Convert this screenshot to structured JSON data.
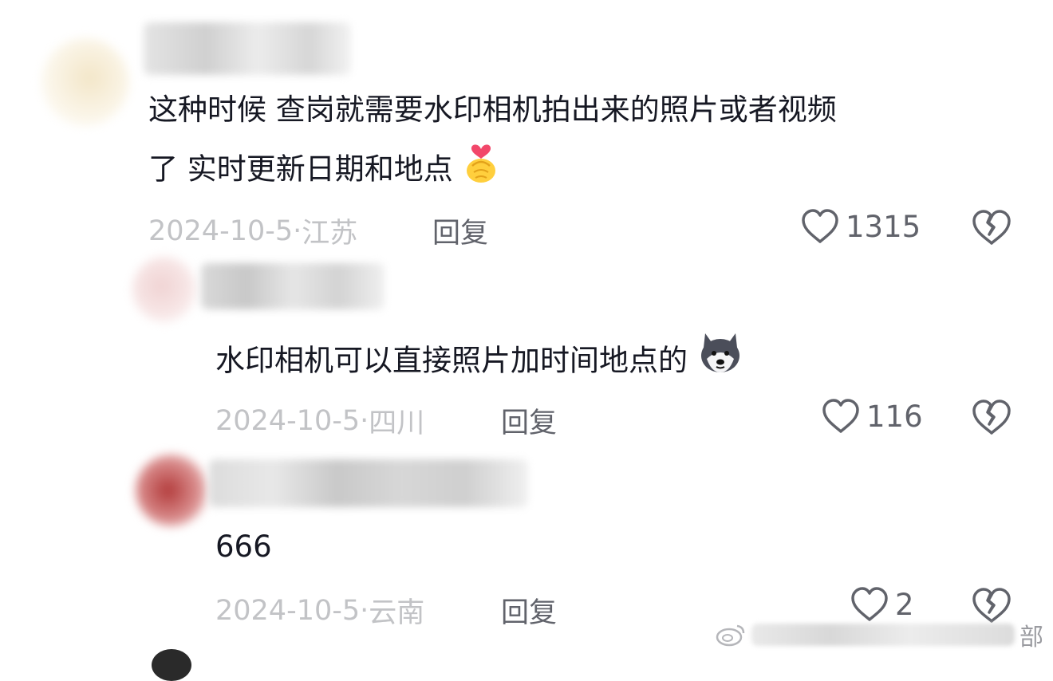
{
  "comments": [
    {
      "lines": [
        "这种时候 查岗就需要水印相机拍出来的照片或者视频",
        "了 实时更新日期和地点"
      ],
      "date": "2024-10-5·",
      "location": "江苏",
      "reply_label": "回复",
      "likes": "1315",
      "emoji": "finger-heart"
    },
    {
      "lines": [
        "水印相机可以直接照片加时间地点的"
      ],
      "date": "2024-10-5·",
      "location": "四川",
      "reply_label": "回复",
      "likes": "116",
      "emoji": "husky-dog"
    },
    {
      "lines": [
        "666"
      ],
      "date": "2024-10-5·",
      "location": "云南",
      "reply_label": "回复",
      "likes": "2"
    }
  ],
  "watermark": {
    "text": "部"
  },
  "colors": {
    "text": "#161823",
    "meta": "#c2c3c6",
    "action": "#61636b"
  }
}
